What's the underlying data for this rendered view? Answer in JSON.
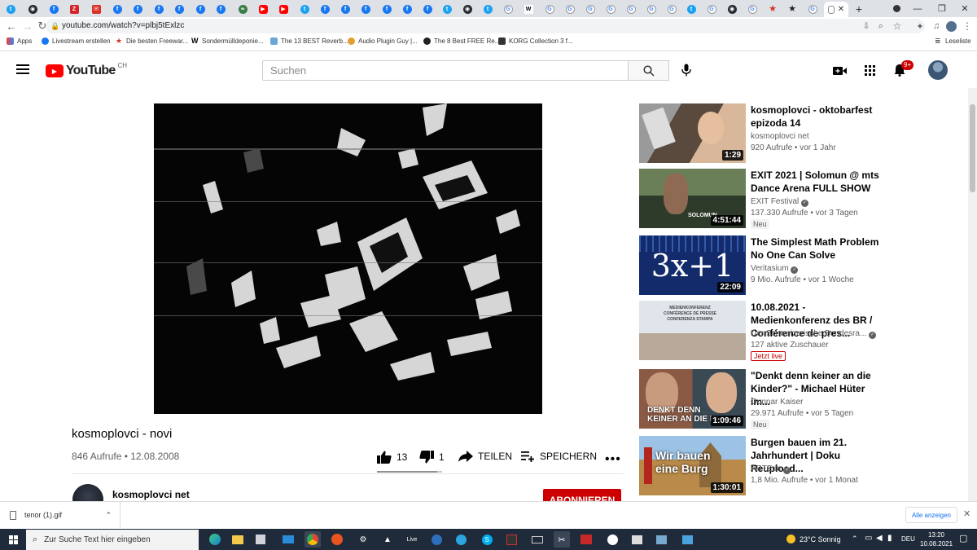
{
  "browser": {
    "url": "youtube.com/watch?v=plbj5tExlzc",
    "active_tab_close": "✕",
    "new_tab": "+",
    "bookmarks": [
      {
        "label": "Apps"
      },
      {
        "label": "Livestream erstellen"
      },
      {
        "label": "Die besten Freewar..."
      },
      {
        "label": "Sondermülldeponie..."
      },
      {
        "label": "The 13 BEST Reverb..."
      },
      {
        "label": "Audio Plugin Guy |..."
      },
      {
        "label": "The 8 Best FREE Re..."
      },
      {
        "label": "KORG Collection 3 f..."
      }
    ],
    "reading_list": "Leseliste"
  },
  "youtube": {
    "logo_text": "YouTube",
    "region": "CH",
    "search_placeholder": "Suchen",
    "notifications": "9+"
  },
  "video": {
    "title": "kosmoplovci - novi",
    "views_date": "846 Aufrufe • 12.08.2008",
    "likes": "13",
    "dislikes": "1",
    "share": "TEILEN",
    "save": "SPEICHERN",
    "channel": "kosmoplovci net",
    "subscribe": "ABONNIEREN"
  },
  "related": [
    {
      "title": "kosmoplovci - oktobarfest epizoda 14",
      "channel": "kosmoplovci net",
      "views": "920 Aufrufe • vor 1 Jahr",
      "duration": "1:29",
      "badge": "",
      "live": ""
    },
    {
      "title": "EXIT 2021 | Solomun @ mts Dance Arena FULL SHOW",
      "channel": "EXIT Festival",
      "views": "137.330 Aufrufe • vor 3 Tagen",
      "duration": "4:51:44",
      "badge": "Neu",
      "live": ""
    },
    {
      "title": "The Simplest Math Problem No One Can Solve",
      "channel": "Veritasium",
      "views": "9 Mio. Aufrufe • vor 1 Woche",
      "duration": "22:09",
      "badge": "",
      "live": ""
    },
    {
      "title": "10.08.2021 - Medienkonferenz des BR / Conférence de pres...",
      "channel": "Der Schweizerische Bundesra...",
      "views": "127 aktive Zuschauer",
      "duration": "",
      "badge": "",
      "live": "Jetzt live"
    },
    {
      "title": "\"Denkt denn keiner an die Kinder?\" - Michael Hüter im...",
      "channel": "Gunnar Kaiser",
      "views": "29.971 Aufrufe • vor 5 Tagen",
      "duration": "1:09:46",
      "badge": "Neu",
      "live": ""
    },
    {
      "title": "Burgen bauen im 21. Jahrhundert | Doku Reupload...",
      "channel": "ARTEde",
      "views": "1,8 Mio. Aufrufe • vor 1 Monat",
      "duration": "1:30:01",
      "badge": "",
      "live": ""
    }
  ],
  "thumb_text": {
    "solomun": "SOLOMUN",
    "math": "3x+1",
    "conf_lines": [
      "MEDIENKONFERENZ",
      "CONFÉRENCE DE PRESSE",
      "CONFERENZA STAMPA"
    ],
    "kinder_lines": [
      "DENKT DENN",
      "KEINER AN DIE KI"
    ],
    "burg_lines": [
      "Wir bauen",
      "eine Burg"
    ]
  },
  "download": {
    "file": "tenor (1).gif",
    "show_all": "Alle anzeigen"
  },
  "taskbar": {
    "search": "Zur Suche Text hier eingeben",
    "weather": "23°C  Sonnig",
    "lang": "DEU",
    "time": "13:20",
    "date": "10.08.2021"
  }
}
